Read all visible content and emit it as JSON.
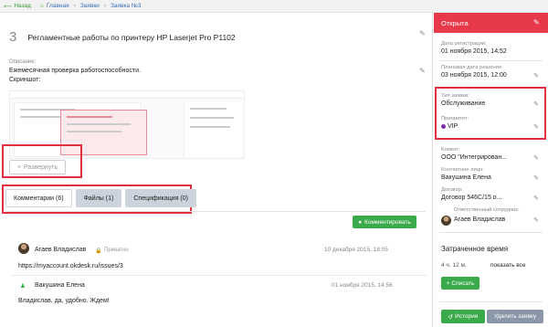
{
  "topbar": {
    "back_label": "Назад",
    "breadcrumb": [
      "Главная",
      "Заявки",
      "Заявка №3"
    ]
  },
  "ticket": {
    "number": "3",
    "title": "Регламентные работы по принтеру HP Laserjet Pro P1102",
    "description_label": "Описание:",
    "description_line1": "Ежемесячная проверка работоспособности.",
    "description_line2": "Скриншот:",
    "expand_label": "Развернуть"
  },
  "tabs": [
    {
      "label": "Комментарии (6)",
      "active": true
    },
    {
      "label": "Файлы (1)",
      "active": false
    },
    {
      "label": "Спецификация (0)",
      "active": false
    }
  ],
  "comment_button": "Комментировать",
  "comments": [
    {
      "author": "Агаев Владислав",
      "private": "Приватно",
      "date": "10 декабря 2015, 18:05",
      "text": "https://myaccount.okdesk.ru/issues/3"
    },
    {
      "author": "Вакушина Елена",
      "date": "01 ноября 2015, 14:56",
      "text": "Владислав, да, удобно. Ждем!"
    }
  ],
  "sidebar": {
    "status": "Открыта",
    "registration_label": "Дата регистрации:",
    "registration_value": "01 ноября 2015, 14:52",
    "planned_label": "Плановая дата решения",
    "planned_value": "03 ноября 2015, 12:00",
    "type_label": "Тип заявки:",
    "type_value": "Обслуживание",
    "priority_label": "Приоритет:",
    "priority_value": "VIP",
    "client_label": "Клиент:",
    "client_value": "ООО \"Интегрирован...",
    "contact_label": "Контактное лицо:",
    "contact_value": "Вакушина Елена",
    "contract_label": "Договор:",
    "contract_value": "Договор 546С/15 о...",
    "responsible_label": "Ответственный сотрудник:",
    "responsible_value": "Агаев Владислав",
    "time_title": "Затраченное время",
    "hours_value": "4 ч. 12 м.",
    "show_all": "показать все",
    "spend_button": "Списать",
    "history_button": "История",
    "delete_button": "Удалить заявку"
  },
  "colors": {
    "status_red": "#e8394a",
    "accent_green": "#3aaa4a",
    "highlight_red": "#e03040",
    "priority_purple": "#7a2fa5"
  }
}
